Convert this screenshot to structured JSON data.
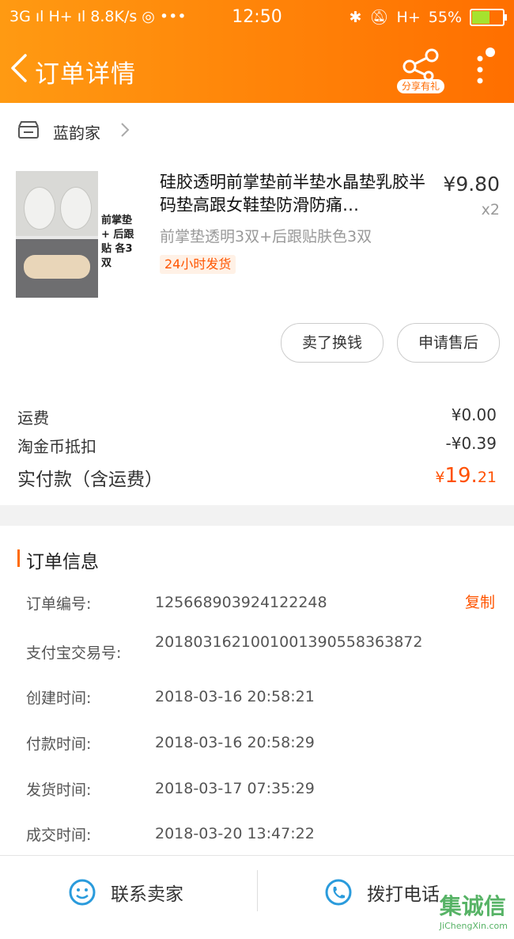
{
  "status_bar": {
    "left": "3G ıl H+ ıl 8.8K/s ◎ •••",
    "time": "12:50",
    "network": "H+",
    "battery": "55%"
  },
  "navbar": {
    "title": "订单详情",
    "share_label": "分享有礼"
  },
  "shop": {
    "name": "蓝韵家"
  },
  "item": {
    "title": "硅胶透明前掌垫前半垫水晶垫乳胶半码垫高跟女鞋垫防滑防痛…",
    "price": "¥9.80",
    "qty": "x2",
    "sku": "前掌垫透明3双+后跟贴肤色3双",
    "badge": "24小时发货",
    "image_caption": "前掌垫 + 后跟贴 各3双",
    "buttons": {
      "sell": "卖了换钱",
      "after_sale": "申请售后"
    }
  },
  "fees": {
    "shipping_label": "运费",
    "shipping_value": "¥0.00",
    "coin_label": "淘金币抵扣",
    "coin_value": "-¥0.39",
    "total_label": "实付款（含运费）",
    "total_symbol": "¥",
    "total_int": "19.",
    "total_dec": "21"
  },
  "order_info": {
    "title": "订单信息",
    "copy_label": "复制",
    "rows": [
      {
        "key": "订单编号:",
        "value": "125668903924122248"
      },
      {
        "key": "支付宝交易号:",
        "value": "2018031621001001390558363872"
      },
      {
        "key": "创建时间:",
        "value": "2018-03-16 20:58:21"
      },
      {
        "key": "付款时间:",
        "value": "2018-03-16 20:58:29"
      },
      {
        "key": "发货时间:",
        "value": "2018-03-17 07:35:29"
      },
      {
        "key": "成交时间:",
        "value": "2018-03-20 13:47:22"
      }
    ]
  },
  "footer": {
    "contact_label": "联系卖家",
    "call_label": "拨打电话"
  },
  "watermark": {
    "main": "集诚信",
    "sub": "JiChengXin.com"
  },
  "colors": {
    "accent": "#ff6a00",
    "price_red": "#ff5000"
  }
}
